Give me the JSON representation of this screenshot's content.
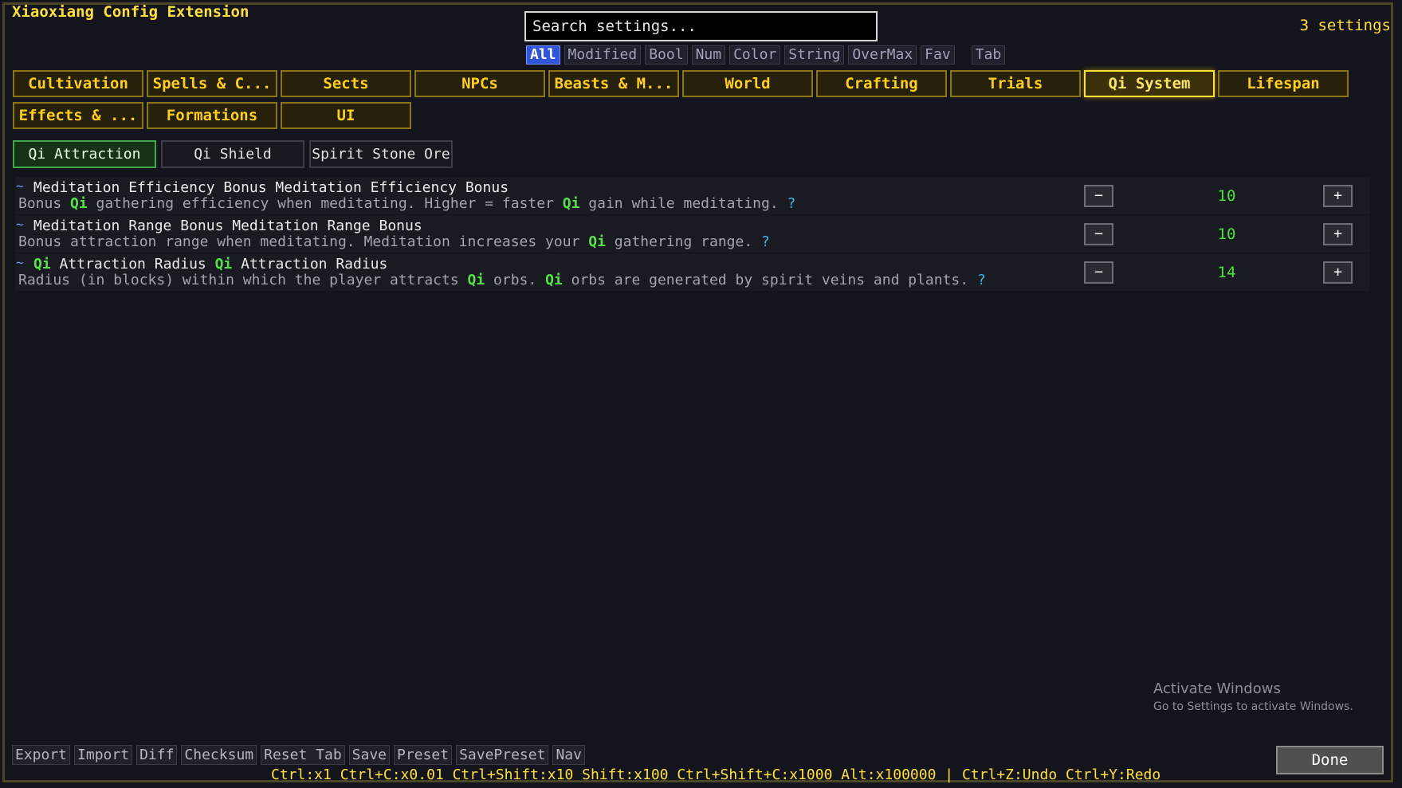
{
  "header": {
    "title": "Xiaoxiang Config Extension",
    "count": "3 settings"
  },
  "search": {
    "placeholder": "Search settings..."
  },
  "filters": [
    "All",
    "Modified",
    "Bool",
    "Num",
    "Color",
    "String",
    "OverMax",
    "Fav",
    "Tab"
  ],
  "categories": [
    "Cultivation",
    "Spells & C...",
    "Sects",
    "NPCs",
    "Beasts & M...",
    "World",
    "Crafting",
    "Trials",
    "Qi System",
    "Lifespan",
    "Effects & ...",
    "Formations",
    "UI"
  ],
  "subtabs": [
    "Qi Attraction",
    "Qi Shield",
    "Spirit Stone Ore"
  ],
  "settings": [
    {
      "tilde": "~",
      "title": "Meditation Efficiency Bonus Meditation Efficiency Bonus",
      "desc": [
        "Bonus ",
        "Qi",
        " gathering efficiency when meditating. Higher = faster ",
        "Qi",
        " gain while meditating. ",
        "?"
      ],
      "value": "10"
    },
    {
      "tilde": "~",
      "title": "Meditation Range Bonus Meditation Range Bonus",
      "desc": [
        "Bonus attraction range when meditating. Meditation increases your ",
        "Qi",
        " gathering range. ",
        "?"
      ],
      "value": "10"
    },
    {
      "tilde": "~",
      "title": [
        "Qi",
        " Attraction Radius ",
        "Qi",
        " Attraction Radius"
      ],
      "desc": [
        "Radius (in blocks) within which the player attracts ",
        "Qi",
        " orbs. ",
        "Qi",
        " orbs are generated by spirit veins and plants. ",
        "?"
      ],
      "value": "14"
    }
  ],
  "controls": {
    "minus": "−",
    "plus": "+"
  },
  "actions": [
    "Export",
    "Import",
    "Diff",
    "Checksum",
    "Reset Tab",
    "Save",
    "Preset",
    "SavePreset",
    "Nav"
  ],
  "shortcuts": "Ctrl:x1  Ctrl+C:x0.01  Ctrl+Shift:x10  Shift:x100  Ctrl+Shift+C:x1000  Alt:x100000  |  Ctrl+Z:Undo  Ctrl+Y:Redo",
  "done": "Done",
  "watermark": {
    "line1": "Activate Windows",
    "line2": "Go to Settings to activate Windows."
  }
}
